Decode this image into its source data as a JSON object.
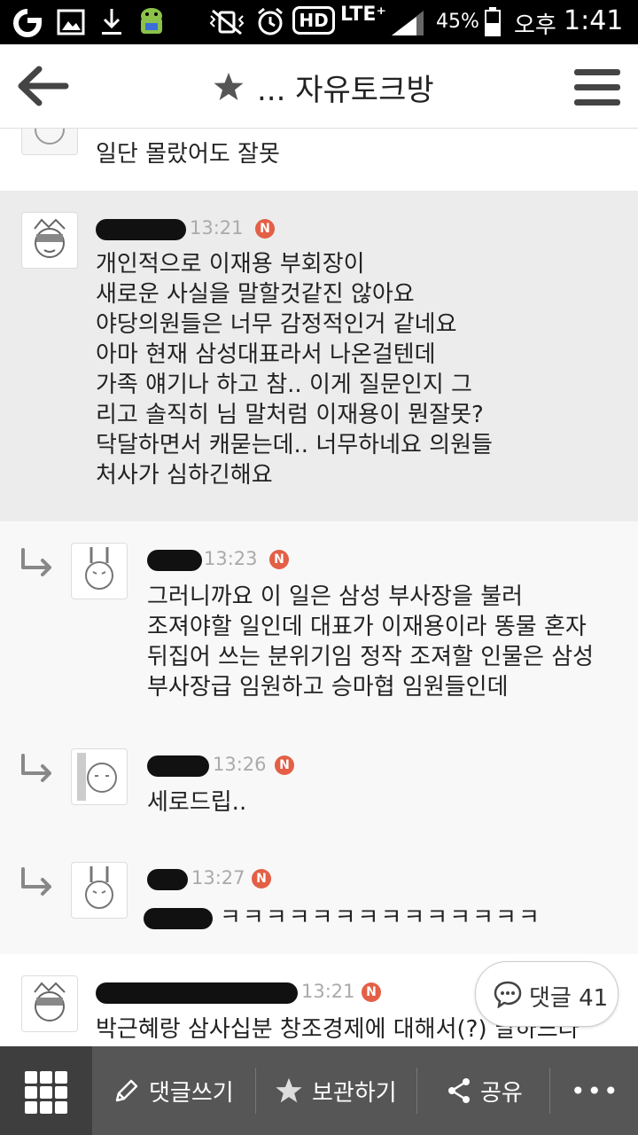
{
  "status_bar": {
    "battery": "45%",
    "ampm": "오후",
    "time": "1:41",
    "lte": "LTE⁺",
    "hd": "HD"
  },
  "header": {
    "title": "... 자유토크방",
    "star_icon": "star-icon"
  },
  "comments": [
    {
      "text": "일단 몰랐어도 잘못"
    },
    {
      "time": "13:21",
      "badge": "N",
      "text": "개인적으로 이재용 부회장이\n새로운 사실을 말할것같진 않아요\n야당의원들은 너무 감정적인거 같네요\n아마 현재 삼성대표라서 나온걸텐데\n가족 얘기나 하고 참.. 이게 질문인지 그\n리고 솔직히 님 말처럼 이재용이 뭔잘못?\n닥달하면서 캐묻는데.. 너무하네요 의원들\n처사가 심하긴해요"
    },
    {
      "time": "13:23",
      "badge": "N",
      "text": "그러니까요 이 일은 삼성 부사장을 불러\n조져야할 일인데 대표가 이재용이라 똥물 혼자\n뒤집어 쓰는 분위기임 정작 조져할 인물은 삼성\n부사장급 임원하고 승마협 임원들인데"
    },
    {
      "time": "13:26",
      "badge": "N",
      "text": "세로드립.."
    },
    {
      "time": "13:27",
      "badge": "N",
      "text": "ㅋㅋㅋㅋㅋㅋㅋㅋㅋㅋㅋㅋㅋㅋ"
    },
    {
      "time": "13:21",
      "badge": "N",
      "text": "박근혜랑 삼사십분 창조경제에 대해서(?) 말하느라"
    }
  ],
  "comment_bubble": {
    "label": "댓글 41"
  },
  "bottom_bar": {
    "write_label": "댓글쓰기",
    "save_label": "보관하기",
    "share_label": "공유",
    "more_label": "•••"
  },
  "colors": {
    "badge": "#e35f45",
    "bottom_bar": "#565656",
    "highlight_row": "#ececec"
  }
}
